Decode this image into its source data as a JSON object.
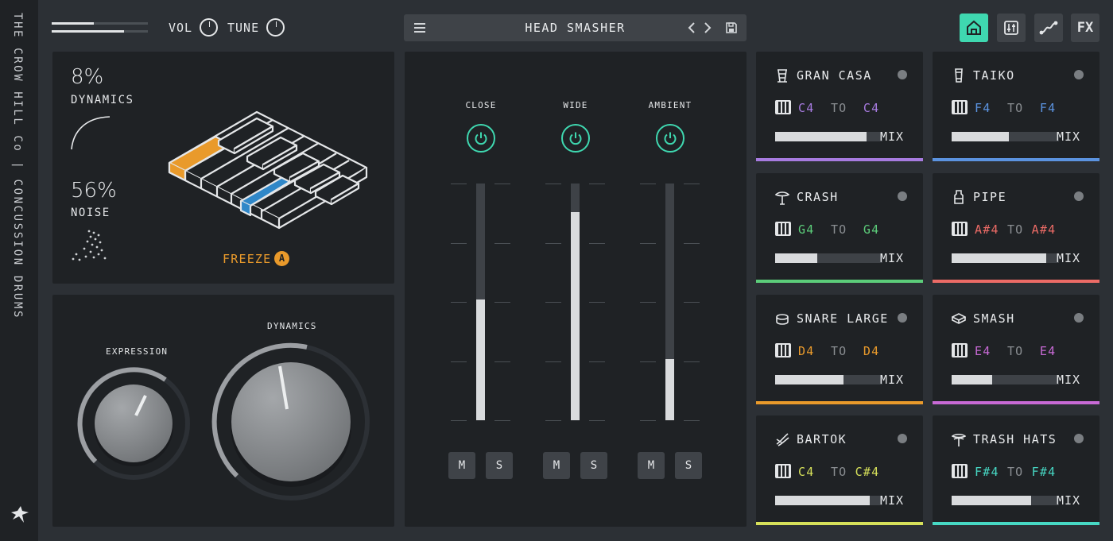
{
  "brand": "THE CROW HILL Co | CONCUSSION DRUMS",
  "top": {
    "levels": [
      0.44,
      0.75
    ],
    "vol_label": "VOL",
    "tune_label": "TUNE",
    "preset_name": "HEAD SMASHER",
    "fx_label": "FX",
    "nav_icons": [
      "home-icon",
      "mixer-icon",
      "curve-icon",
      "fx"
    ]
  },
  "character": {
    "dynamics_pct": "8%",
    "dynamics_label": "DYNAMICS",
    "noise_pct": "56%",
    "noise_label": "NOISE",
    "freeze_label": "FREEZE",
    "freeze_badge": "A"
  },
  "knobs": {
    "expression_label": "EXPRESSION",
    "dynamics_label": "DYNAMICS"
  },
  "mixer": {
    "channels": [
      {
        "label": "CLOSE",
        "level": 0.51,
        "mute": "M",
        "solo": "S"
      },
      {
        "label": "WIDE",
        "level": 0.88,
        "mute": "M",
        "solo": "S"
      },
      {
        "label": "AMBIENT",
        "level": 0.26,
        "mute": "M",
        "solo": "S"
      }
    ]
  },
  "instruments": [
    {
      "name": "GRAN CASA",
      "from": "C4",
      "to_word": "TO",
      "to": "C4",
      "color": "#a77be0",
      "mix": 0.85,
      "mix_label": "MIX",
      "icon": "gran-casa-icon"
    },
    {
      "name": "TAIKO",
      "from": "F4",
      "to_word": "TO",
      "to": "F4",
      "color": "#5b93e0",
      "mix": 0.53,
      "mix_label": "MIX",
      "icon": "taiko-icon"
    },
    {
      "name": "CRASH",
      "from": "G4",
      "to_word": "TO",
      "to": "G4",
      "color": "#5ccd7a",
      "mix": 0.39,
      "mix_label": "MIX",
      "icon": "crash-icon"
    },
    {
      "name": "PIPE",
      "from": "A#4",
      "to_word": "TO",
      "to": "A#4",
      "color": "#ec6b66",
      "mix": 0.88,
      "mix_label": "MIX",
      "icon": "pipe-icon"
    },
    {
      "name": "SNARE LARGE",
      "from": "D4",
      "to_word": "TO",
      "to": "D4",
      "color": "#e99a2b",
      "mix": 0.64,
      "mix_label": "MIX",
      "icon": "snare-icon"
    },
    {
      "name": "SMASH",
      "from": "E4",
      "to_word": "TO",
      "to": "E4",
      "color": "#c86ad6",
      "mix": 0.38,
      "mix_label": "MIX",
      "icon": "smash-icon"
    },
    {
      "name": "BARTOK",
      "from": "C4",
      "to_word": "TO",
      "to": "C#4",
      "color": "#d6e05a",
      "mix": 0.88,
      "mix_label": "MIX",
      "icon": "bartok-icon"
    },
    {
      "name": "TRASH HATS",
      "from": "F#4",
      "to_word": "TO",
      "to": "F#4",
      "color": "#47d8c4",
      "mix": 0.74,
      "mix_label": "MIX",
      "icon": "hats-icon"
    }
  ]
}
